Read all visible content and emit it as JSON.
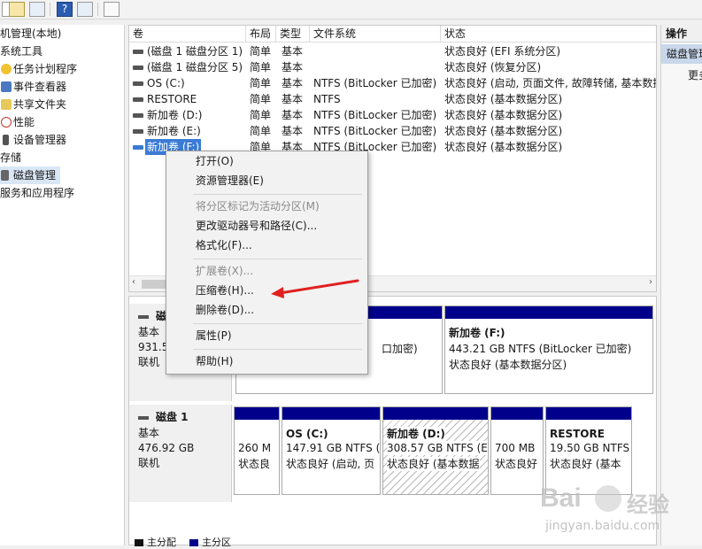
{
  "tree": {
    "items": [
      {
        "label": "机管理(本地)"
      },
      {
        "label": "系统工具"
      },
      {
        "label": "任务计划程序"
      },
      {
        "label": "事件查看器"
      },
      {
        "label": "共享文件夹"
      },
      {
        "label": "性能"
      },
      {
        "label": "设备管理器"
      },
      {
        "label": "存储"
      },
      {
        "label": "磁盘管理"
      },
      {
        "label": "服务和应用程序"
      }
    ]
  },
  "volume_list": {
    "headers": [
      "卷",
      "布局",
      "类型",
      "文件系统",
      "状态"
    ],
    "rows": [
      {
        "volume": "(磁盘 1 磁盘分区 1)",
        "layout": "简单",
        "type": "基本",
        "fs": "",
        "status": "状态良好 (EFI 系统分区)"
      },
      {
        "volume": "(磁盘 1 磁盘分区 5)",
        "layout": "简单",
        "type": "基本",
        "fs": "",
        "status": "状态良好 (恢复分区)"
      },
      {
        "volume": "OS (C:)",
        "layout": "简单",
        "type": "基本",
        "fs": "NTFS (BitLocker 已加密)",
        "status": "状态良好 (启动, 页面文件, 故障转储, 基本数据"
      },
      {
        "volume": "RESTORE",
        "layout": "简单",
        "type": "基本",
        "fs": "NTFS",
        "status": "状态良好 (基本数据分区)"
      },
      {
        "volume": "新加卷 (D:)",
        "layout": "简单",
        "type": "基本",
        "fs": "NTFS (BitLocker 已加密)",
        "status": "状态良好 (基本数据分区)"
      },
      {
        "volume": "新加卷 (E:)",
        "layout": "简单",
        "type": "基本",
        "fs": "NTFS (BitLocker 已加密)",
        "status": "状态良好 (基本数据分区)"
      },
      {
        "volume": "新加卷 (F:)",
        "layout": "简单",
        "type": "基本",
        "fs": "NTFS (BitLocker 已加密)",
        "status": "状态良好 (基本数据分区)"
      }
    ]
  },
  "actions": {
    "title": "操作",
    "section": "磁盘管理",
    "more": "更多"
  },
  "disk0": {
    "name": "磁",
    "type": "基本",
    "size": "931.5",
    "status": "联机",
    "part_e_fs": "口加密)",
    "part_f": {
      "name": "新加卷 (F:)",
      "size": "443.21 GB NTFS (BitLocker 已加密)",
      "status": "状态良好 (基本数据分区)"
    }
  },
  "disk1": {
    "name": "磁盘 1",
    "type": "基本",
    "size": "476.92 GB",
    "status": "联机",
    "parts": [
      {
        "name": "",
        "size": "260 M",
        "status": "状态良"
      },
      {
        "name": "OS  (C:)",
        "size": "147.91 GB NTFS (",
        "status": "状态良好 (启动, 页"
      },
      {
        "name": "新加卷  (D:)",
        "size": "308.57 GB NTFS (E",
        "status": "状态良好 (基本数据"
      },
      {
        "name": "",
        "size": "700 MB",
        "status": "状态良好"
      },
      {
        "name": "RESTORE",
        "size": "19.50 GB NTFS",
        "status": "状态良好 (基本"
      }
    ]
  },
  "legend": {
    "primary": "主分配",
    "secondary": "主分区"
  },
  "context_menu": {
    "items": [
      {
        "label": "打开(O)",
        "disabled": false
      },
      {
        "label": "资源管理器(E)",
        "disabled": false
      },
      {
        "label": "将分区标记为活动分区(M)",
        "disabled": true
      },
      {
        "label": "更改驱动器号和路径(C)...",
        "disabled": false
      },
      {
        "label": "格式化(F)...",
        "disabled": false
      },
      {
        "label": "扩展卷(X)...",
        "disabled": true
      },
      {
        "label": "压缩卷(H)...",
        "disabled": false
      },
      {
        "label": "删除卷(D)...",
        "disabled": false
      },
      {
        "label": "属性(P)",
        "disabled": false
      },
      {
        "label": "帮助(H)",
        "disabled": false
      }
    ]
  },
  "colors": {
    "partition_bar": "#00008b",
    "selection": "#3a7bd5",
    "arrow": "#e02020"
  },
  "watermark": {
    "brand": "Bai",
    "brand2": "经验",
    "url": "jingyan.baidu.com"
  }
}
